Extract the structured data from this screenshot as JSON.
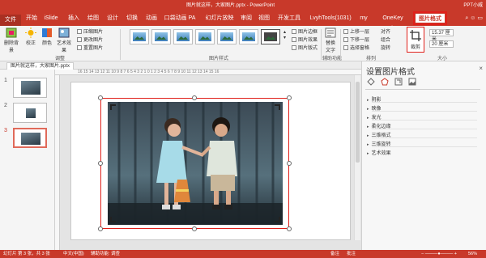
{
  "app": {
    "doc_title": "图片就这样，大家图片.pptx - PowerPoint",
    "user": "PPT小威"
  },
  "tabs": [
    {
      "label": "文件"
    },
    {
      "label": "开始"
    },
    {
      "label": "iSlide"
    },
    {
      "label": "插入"
    },
    {
      "label": "绘图"
    },
    {
      "label": "设计"
    },
    {
      "label": "切换"
    },
    {
      "label": "动画"
    },
    {
      "label": "口袋动画 PA"
    },
    {
      "label": "幻灯片放映"
    },
    {
      "label": "审阅"
    },
    {
      "label": "视图"
    },
    {
      "label": "开发工具"
    },
    {
      "label": "LvyhTools(1031)"
    },
    {
      "label": "my"
    },
    {
      "label": "OneKey Lite"
    },
    {
      "label": "图片格式"
    }
  ],
  "ribbon": {
    "remove_bg": "删除背景",
    "corrections": "校正",
    "color": "颜色",
    "artistic": "艺术效果",
    "compress": "压缩图片",
    "change_pic": "更改图片",
    "reset_pic": "重置图片",
    "adjust_group": "调整",
    "styles_group": "图片样式",
    "pic_border": "图片边框",
    "pic_effects": "图片效果",
    "pic_layout": "图片版式",
    "alt_text": "替换文字",
    "accessibility_group": "辅助功能",
    "bring_forward": "上移一层",
    "send_backward": "下移一层",
    "selection_pane": "选择窗格",
    "align": "对齐",
    "group": "组合",
    "rotate": "旋转",
    "arrange_group": "排列",
    "crop": "裁剪",
    "height": "15.37 厘米",
    "width": "20 厘米",
    "size_group": "大小"
  },
  "filetab": {
    "name": "图片就这样，大家图片.pptx"
  },
  "ruler": {
    "labels": "16 15 14 13 12 11 10 9 8 7 6 5 4 3 2 1 0 1 2 3 4 5 6 7 8 9 10 11 12 13 14 15 16"
  },
  "slides": [
    {
      "num": "1"
    },
    {
      "num": "2"
    },
    {
      "num": "3"
    }
  ],
  "panel": {
    "title": "设置图片格式",
    "close": "×",
    "sections": [
      "阴影",
      "映像",
      "发光",
      "柔化边缘",
      "三维格式",
      "三维旋转",
      "艺术效果"
    ]
  },
  "status": {
    "slide_info": "幻灯片 第 3 张，共 3 张",
    "lang": "中文(中国)",
    "accessibility": "辅助功能: 调查",
    "notes": "备注",
    "comments": "批注",
    "zoom": "56%"
  },
  "colors": {
    "accent": "#c8392a",
    "selection": "#e0201a"
  }
}
